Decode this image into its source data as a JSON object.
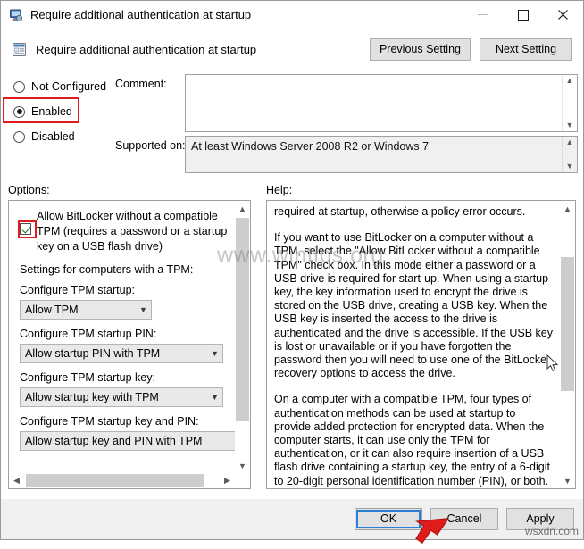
{
  "window": {
    "title": "Require additional authentication at startup",
    "icon": "monitor-policy-icon",
    "minimize_label": "Minimize",
    "maximize_label": "Maximize",
    "close_label": "Close"
  },
  "header": {
    "icon": "policy-setting-icon",
    "title": "Require additional authentication at startup",
    "previous_setting": "Previous Setting",
    "next_setting": "Next Setting"
  },
  "state": {
    "options": [
      {
        "label": "Not Configured",
        "selected": false
      },
      {
        "label": "Enabled",
        "selected": true
      },
      {
        "label": "Disabled",
        "selected": false
      }
    ],
    "highlighted_option": "Enabled"
  },
  "fields": {
    "comment_label": "Comment:",
    "comment_value": "",
    "supported_label": "Supported on:",
    "supported_value": "At least Windows Server 2008 R2 or Windows 7"
  },
  "options_panel": {
    "label": "Options:",
    "checkbox": {
      "label": "Allow BitLocker without a compatible TPM (requires a password or a startup key on a USB flash drive)",
      "checked": true,
      "highlighted": true
    },
    "section_heading": "Settings for computers with a TPM:",
    "dropdowns": [
      {
        "caption": "Configure TPM startup:",
        "value": "Allow TPM"
      },
      {
        "caption": "Configure TPM startup PIN:",
        "value": "Allow startup PIN with TPM"
      },
      {
        "caption": "Configure TPM startup key:",
        "value": "Allow startup key with TPM"
      },
      {
        "caption": "Configure TPM startup key and PIN:",
        "value": "Allow startup key and PIN with TPM"
      }
    ]
  },
  "help_panel": {
    "label": "Help:",
    "paragraphs": [
      "required at startup, otherwise a policy error occurs.",
      "If you want to use BitLocker on a computer without a TPM, select the \"Allow BitLocker without a compatible TPM\" check box. In this mode either a password or a USB drive is required for start-up. When using a startup key, the key information used to encrypt the drive is stored on the USB drive, creating a USB key. When the USB key is inserted the access to the drive is authenticated and the drive is accessible. If the USB key is lost or unavailable or if you have forgotten the password then you will need to use one of the BitLocker recovery options to access the drive.",
      "On a computer with a compatible TPM, four types of authentication methods can be used at startup to provide added protection for encrypted data. When the computer starts, it can use only the TPM for authentication, or it can also require insertion of a USB flash drive containing a startup key, the entry of a 6-digit to 20-digit personal identification number (PIN), or both."
    ]
  },
  "footer": {
    "ok": "OK",
    "cancel": "Cancel",
    "apply": "Apply",
    "default_button": "OK"
  },
  "watermarks": {
    "primary": "www.wintips.org",
    "secondary": "wsxdn.com"
  },
  "colors": {
    "highlight_red": "#e01b1b",
    "focus_blue": "#2a7fd4",
    "button_face": "#e1e1e1",
    "window_face": "#f0f0f0"
  }
}
